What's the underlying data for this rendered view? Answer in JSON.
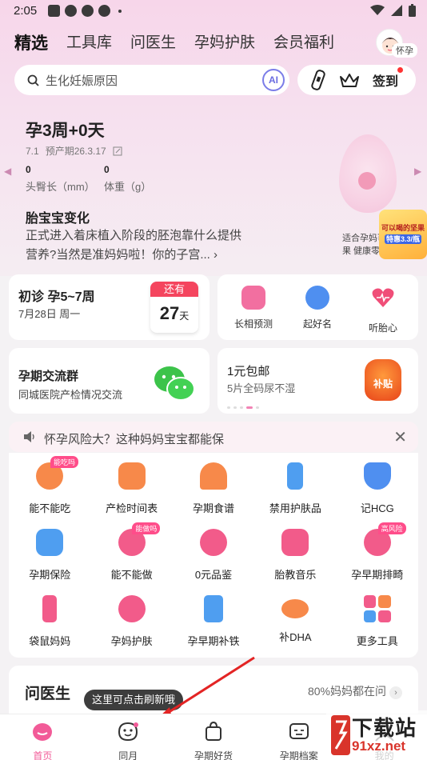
{
  "status_bar": {
    "time": "2:05"
  },
  "nav": {
    "tabs": [
      "精选",
      "工具库",
      "问医生",
      "孕妈护肤",
      "会员福利"
    ],
    "avatar_badge": "怀孕"
  },
  "search": {
    "placeholder": "生化妊娠原因",
    "ai_label": "AI",
    "signin_label": "签到"
  },
  "pregnancy": {
    "week": "孕3周+0天",
    "date": "7.1",
    "due_label": "预产期26.3.17",
    "crl_value": "0",
    "crl_label": "头臀长（mm）",
    "weight_value": "0",
    "weight_label": "体重（g）",
    "change_title": "胎宝宝变化",
    "change_text": "正式进入着床植入阶段的胚泡靠什么提供营养?当然是准妈妈啦！你的子宫..."
  },
  "ad": {
    "text": "适合孕妈可以喝的坚果 健康零食",
    "sticker_line1": "可以喝的坚果",
    "sticker_price": "特惠3.3/瓶"
  },
  "visit": {
    "title": "初诊 孕5~7周",
    "date": "7月28日 周一",
    "remain_label": "还有",
    "days": "27",
    "day_unit": "天"
  },
  "tools3": [
    {
      "label": "长相预测",
      "color": "#f26fa0"
    },
    {
      "label": "起好名",
      "color": "#4f8ff0"
    },
    {
      "label": "听胎心",
      "color": "#f04e78"
    }
  ],
  "group": {
    "title": "孕期交流群",
    "subtitle": "同城医院产检情况交流"
  },
  "promo": {
    "title": "1元包邮",
    "subtitle": "5片全码尿不湿",
    "bag_label": "补贴"
  },
  "notice": {
    "text": "怀孕风险大？这种妈妈宝宝都能保"
  },
  "grid": [
    {
      "label": "能不能吃",
      "tag": "能吃吗",
      "color": "#f7894a"
    },
    {
      "label": "产检时间表",
      "tag": "",
      "color": "#f7894a"
    },
    {
      "label": "孕期食谱",
      "tag": "",
      "color": "#f7894a"
    },
    {
      "label": "禁用护肤品",
      "tag": "",
      "color": "#4f9ef0"
    },
    {
      "label": "记HCG",
      "tag": "",
      "color": "#4f8ff0"
    },
    {
      "label": "孕期保险",
      "tag": "",
      "color": "#4f9ef0"
    },
    {
      "label": "能不能做",
      "tag": "能做吗",
      "color": "#f25b8a"
    },
    {
      "label": "0元品鉴",
      "tag": "",
      "color": "#f25b8a"
    },
    {
      "label": "胎教音乐",
      "tag": "",
      "color": "#f25b8a"
    },
    {
      "label": "孕早期排畸",
      "tag": "高风险",
      "color": "#f25b8a"
    },
    {
      "label": "袋鼠妈妈",
      "tag": "",
      "color": "#f25b8a"
    },
    {
      "label": "孕妈护肤",
      "tag": "",
      "color": "#f25b8a"
    },
    {
      "label": "孕早期补铁",
      "tag": "",
      "color": "#4f9ef0"
    },
    {
      "label": "补DHA",
      "tag": "",
      "color": "#f7894a"
    },
    {
      "label": "更多工具",
      "tag": "",
      "color": "#f25b8a"
    }
  ],
  "ask": {
    "title": "问医生",
    "right_text": "80%妈妈都在问"
  },
  "bottom_nav": {
    "tooltip": "这里可点击刷新哦",
    "items": [
      "首页",
      "同月",
      "孕期好货",
      "孕期档案",
      "我的"
    ]
  },
  "watermark": {
    "title": "下载站",
    "site": "91xz.net"
  }
}
